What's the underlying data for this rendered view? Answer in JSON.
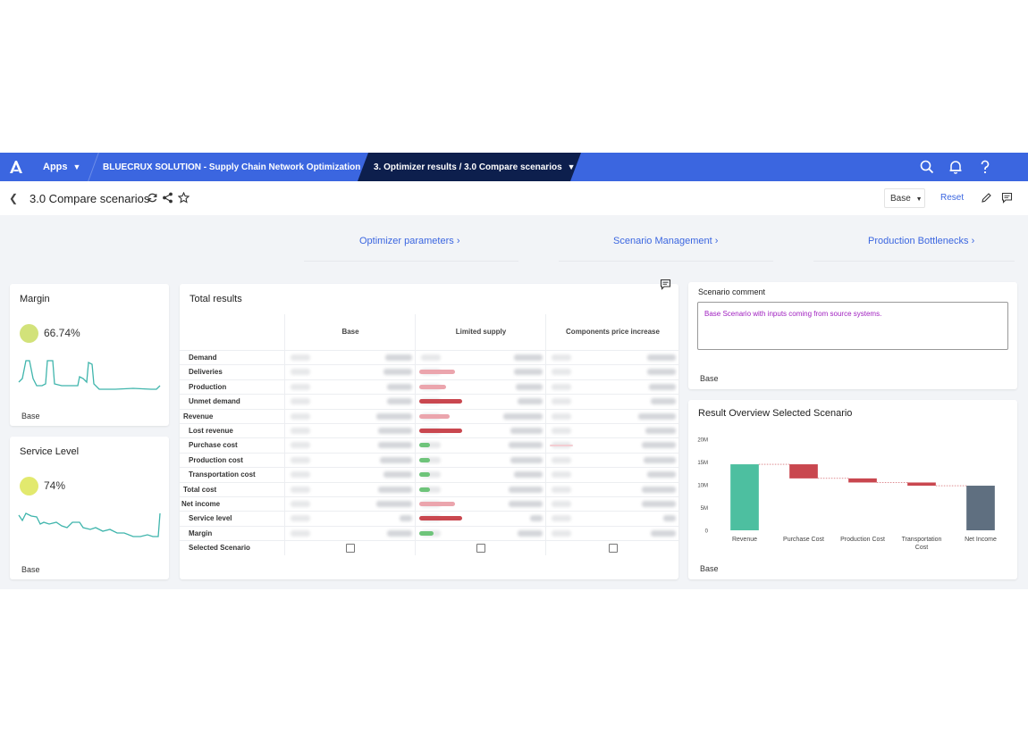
{
  "topbar": {
    "apps_label": "Apps",
    "solution_label": "BLUECRUX SOLUTION - Supply Chain Network Optimization",
    "active_label": "3. Optimizer results / 3.0 Compare scenarios",
    "accent": "#3b66e0",
    "active_bg": "#0d1f4d"
  },
  "subheader": {
    "title": "3.0 Compare scenarios",
    "base_select": "Base",
    "reset_label": "Reset"
  },
  "nav": {
    "links": [
      "Optimizer parameters",
      "Scenario Management",
      "Production Bottlenecks"
    ]
  },
  "margin_card": {
    "title": "Margin",
    "value": "66.74%",
    "footer": "Base",
    "dot_color": "#d2e27a"
  },
  "service_card": {
    "title": "Service Level",
    "value": "74%",
    "footer": "Base",
    "dot_color": "#e2e96e"
  },
  "total_results": {
    "title": "Total results",
    "columns": [
      "Base",
      "Limited supply",
      "Components price increase"
    ],
    "rows": [
      {
        "label": "Demand"
      },
      {
        "label": "Deliveries"
      },
      {
        "label": "Production"
      },
      {
        "label": "Unmet demand"
      },
      {
        "label": "Revenue"
      },
      {
        "label": "Lost revenue"
      },
      {
        "label": "Purchase cost"
      },
      {
        "label": "Production cost"
      },
      {
        "label": "Transportation cost"
      },
      {
        "label": "Total cost"
      },
      {
        "label": "Net income"
      },
      {
        "label": "Service level"
      },
      {
        "label": "Margin"
      },
      {
        "label": "Selected Scenario"
      }
    ],
    "bar_colors": {
      "red": "#c9474f",
      "pink": "#eba5ad",
      "green": "#6ec47a"
    }
  },
  "scenario_comment": {
    "title": "Scenario comment",
    "text": "Base Scenario with inputs coming from source systems.",
    "footer": "Base"
  },
  "result_overview": {
    "title": "Result Overview Selected Scenario",
    "footer": "Base"
  },
  "chart_data": {
    "type": "bar",
    "title": "Result Overview Selected Scenario",
    "categories": [
      "Revenue",
      "Purchase Cost",
      "Production Cost",
      "Transportation Cost",
      "Net Income"
    ],
    "category_lines": [
      [
        "Revenue"
      ],
      [
        "Purchase Cost"
      ],
      [
        "Production Cost"
      ],
      [
        "Transportation",
        "Cost"
      ],
      [
        "Net Income"
      ]
    ],
    "waterfall": [
      {
        "start": 0,
        "end": 14.5,
        "color": "#4dbfa0"
      },
      {
        "start": 14.5,
        "end": 11.4,
        "color": "#c9474f"
      },
      {
        "start": 11.4,
        "end": 10.5,
        "color": "#c9474f"
      },
      {
        "start": 10.5,
        "end": 9.8,
        "color": "#c9474f"
      },
      {
        "start": 0,
        "end": 9.8,
        "color": "#5f6f80"
      }
    ],
    "yticks": [
      "0",
      "5M",
      "10M",
      "15M",
      "20M"
    ],
    "ylim": [
      0,
      20
    ],
    "xlabel": "",
    "ylabel": ""
  }
}
